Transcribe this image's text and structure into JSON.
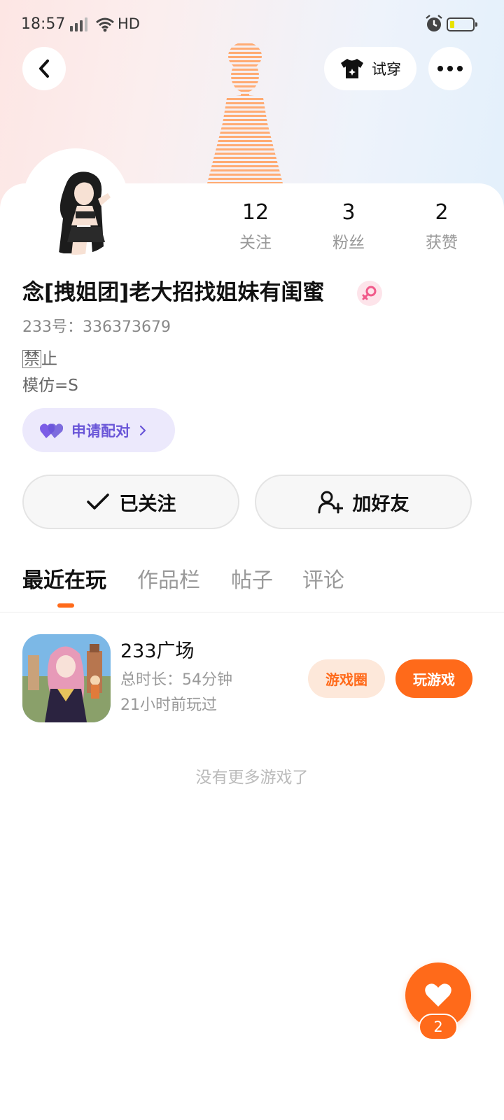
{
  "status_bar": {
    "time": "18:57",
    "network": "4G",
    "hd": "HD"
  },
  "header": {
    "tryon_label": "试穿"
  },
  "stats": [
    {
      "value": "12",
      "label": "关注"
    },
    {
      "value": "3",
      "label": "粉丝"
    },
    {
      "value": "2",
      "label": "获赞"
    }
  ],
  "profile": {
    "nickname": "念[拽姐团]老大招找姐妹有闺蜜",
    "uid": "233号：336373679",
    "bio_box_char": "禁",
    "bio_line1_rest": "止",
    "bio_line2": "模仿=S",
    "gender": "female"
  },
  "pair_button": {
    "label": "申请配对"
  },
  "actions": {
    "follow_label": "已关注",
    "add_friend_label": "加好友"
  },
  "tabs": [
    {
      "label": "最近在玩",
      "active": true
    },
    {
      "label": "作品栏",
      "active": false
    },
    {
      "label": "帖子",
      "active": false
    },
    {
      "label": "评论",
      "active": false
    }
  ],
  "recent_game": {
    "name": "233广场",
    "duration": "总时长：54分钟",
    "last_played": "21小时前玩过",
    "circle_label": "游戏圈",
    "play_label": "玩游戏"
  },
  "no_more_text": "没有更多游戏了",
  "like": {
    "count": "2"
  },
  "colors": {
    "accent": "#ff6a1a",
    "pair_text": "#6a56d8",
    "pair_bg": "#ece9fc",
    "avatar_stripe": "#ffab73"
  }
}
